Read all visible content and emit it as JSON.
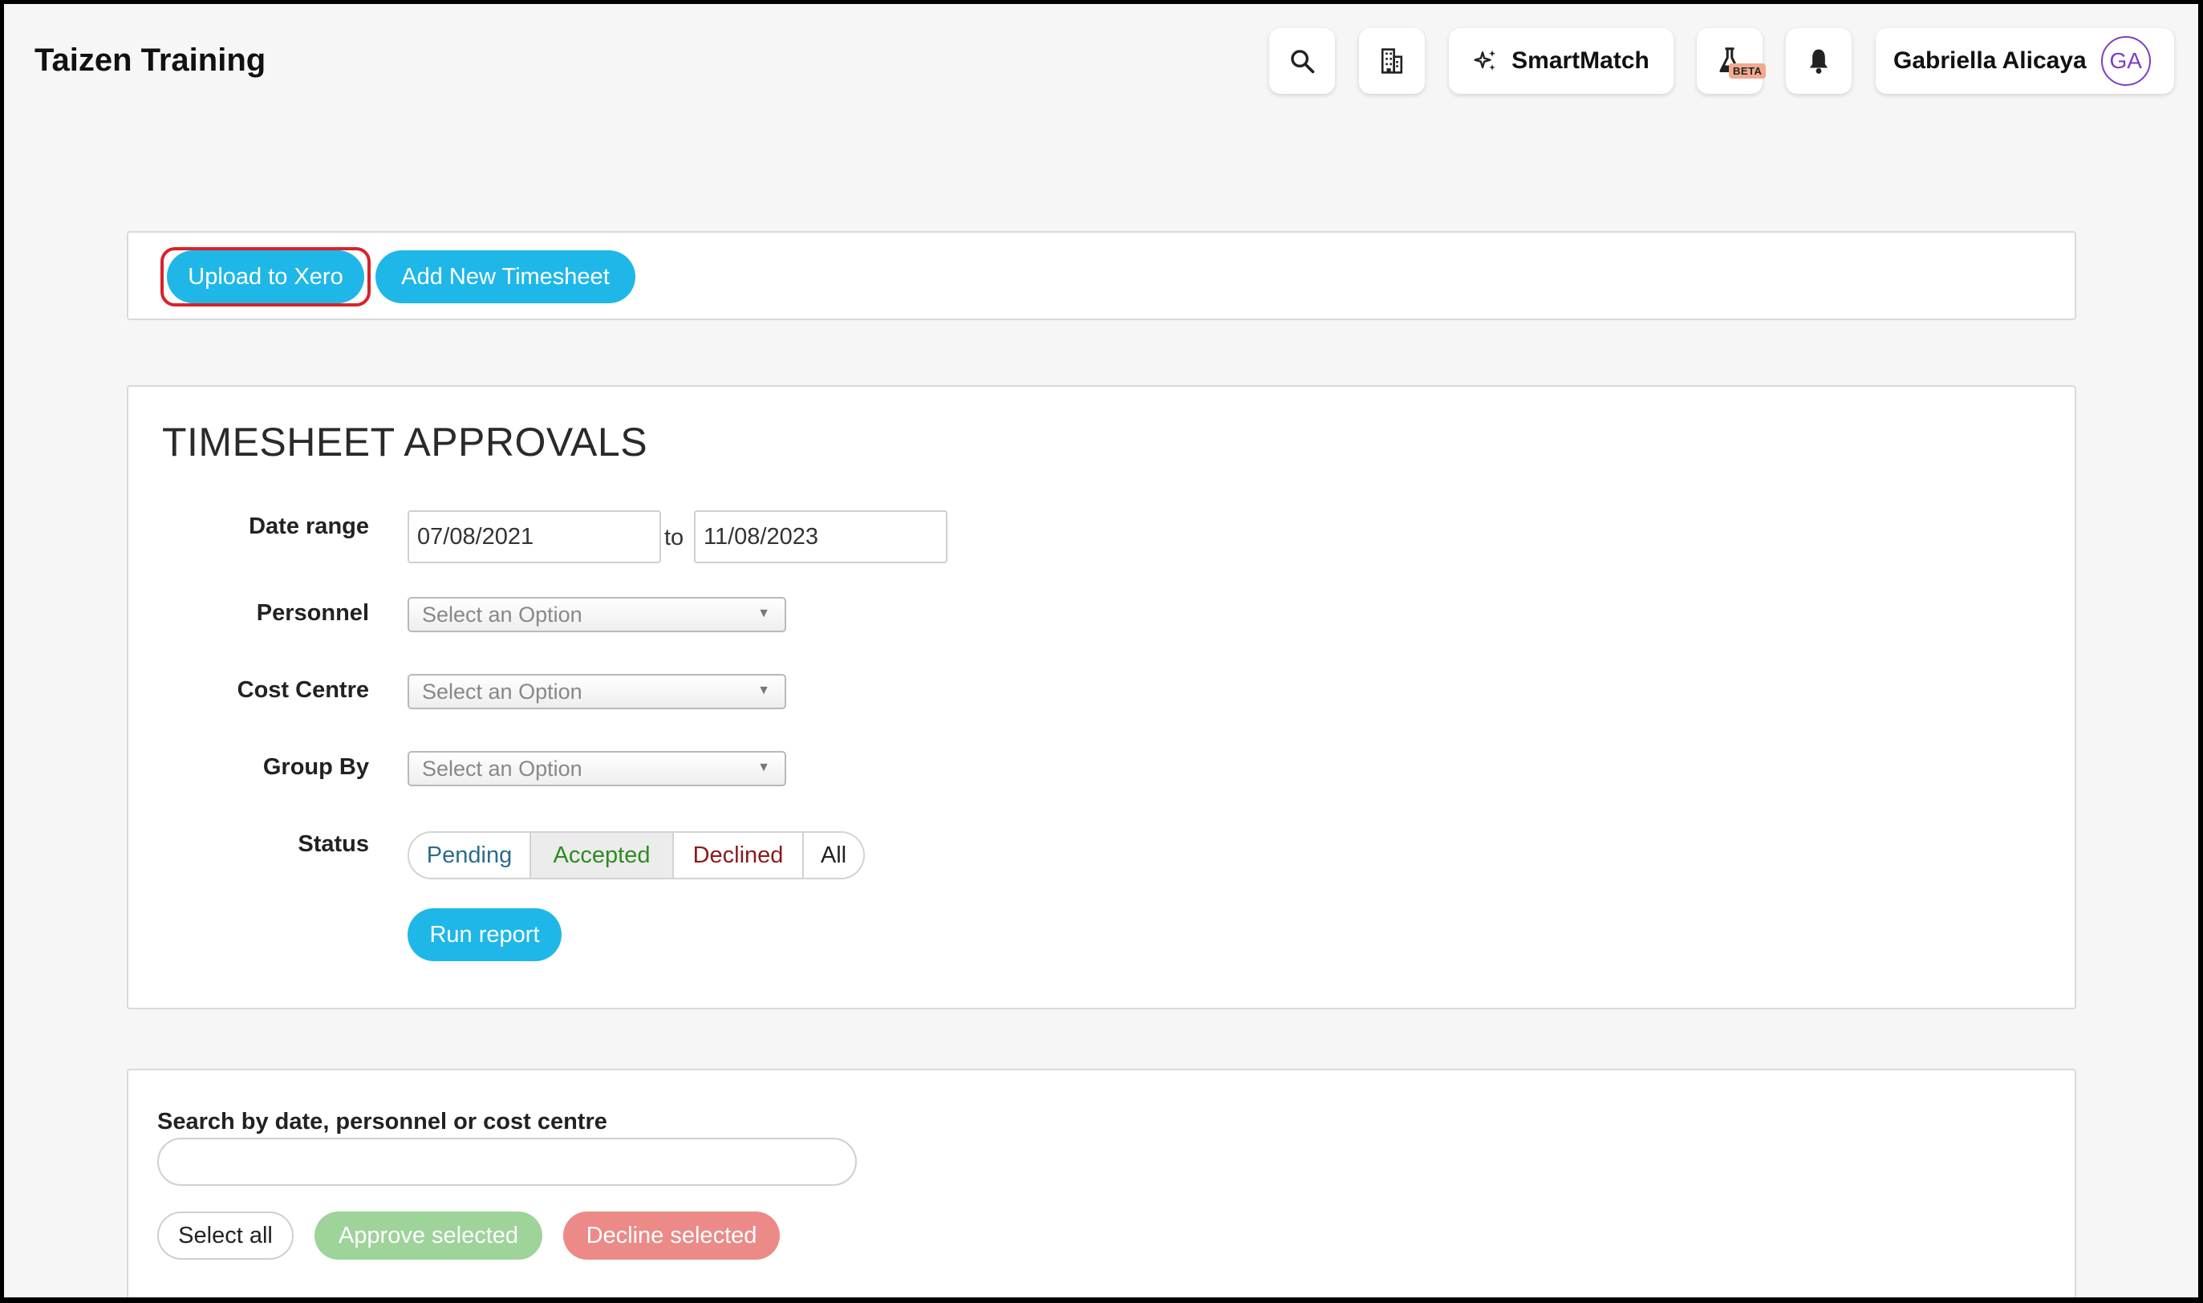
{
  "header": {
    "app_title": "Taizen Training",
    "search_icon": "search-icon",
    "building_icon": "building-icon",
    "smartmatch_label": "SmartMatch",
    "smartmatch_icon": "sparkle-icon",
    "lab_icon": "flask-icon",
    "beta_label": "BETA",
    "bell_icon": "bell-icon",
    "user_name": "Gabriella Alicaya",
    "user_initials": "GA"
  },
  "actions": {
    "upload_label": "Upload to Xero",
    "add_label": "Add New Timesheet"
  },
  "approvals": {
    "title": "TIMESHEET APPROVALS",
    "date_range_label": "Date range",
    "date_from": "07/08/2021",
    "to_text": "to",
    "date_to": "11/08/2023",
    "personnel_label": "Personnel",
    "personnel_placeholder": "Select an Option",
    "cost_centre_label": "Cost Centre",
    "cost_centre_placeholder": "Select an Option",
    "group_by_label": "Group By",
    "group_by_placeholder": "Select an Option",
    "status_label": "Status",
    "status_options": [
      "Pending",
      "Accepted",
      "Declined",
      "All"
    ],
    "status_selected": "Accepted",
    "run_label": "Run report"
  },
  "search": {
    "label": "Search by date, personnel or cost centre",
    "value": "",
    "select_all_label": "Select all",
    "approve_label": "Approve selected",
    "decline_label": "Decline selected"
  },
  "colors": {
    "accent": "#1fb7e8",
    "highlight_border": "#d8232a",
    "avatar": "#7b3fc4",
    "approve": "#9ed39a",
    "decline": "#ec8a88",
    "accepted_text": "#2e8b22",
    "declined_text": "#8b1a1a",
    "pending_text": "#2b6b8c"
  }
}
